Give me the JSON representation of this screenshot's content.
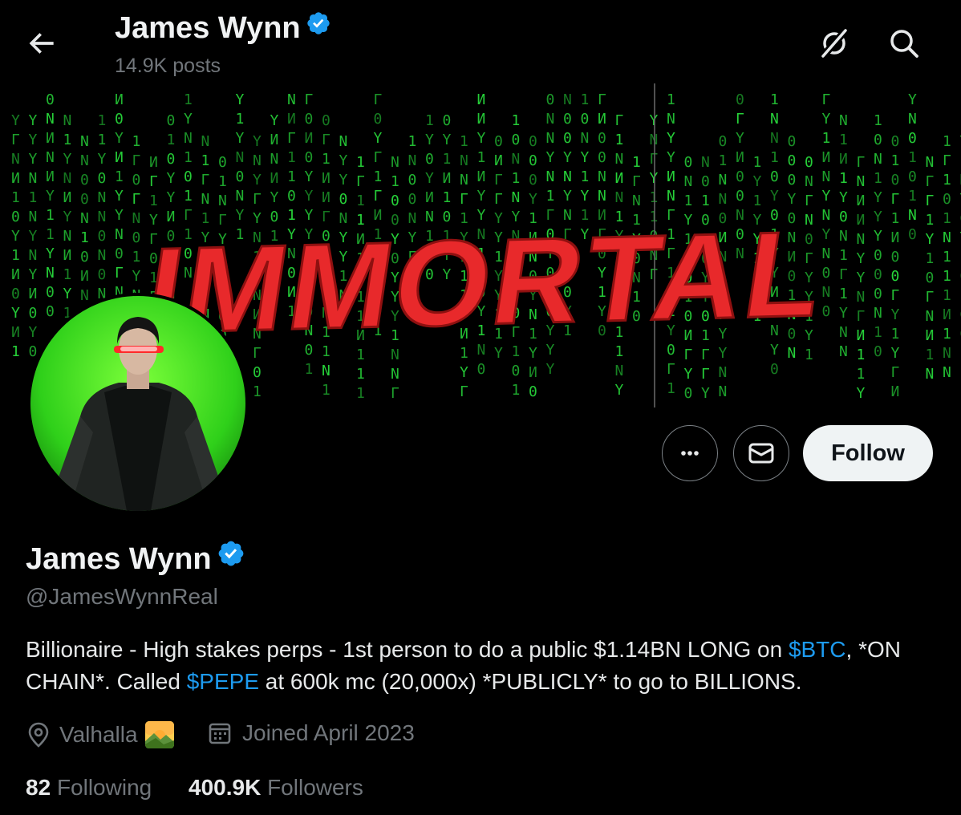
{
  "header": {
    "name": "James Wynn",
    "posts": "14.9K posts",
    "back_icon": "arrow-left-icon",
    "grok_icon": "grok-icon",
    "search_icon": "search-icon"
  },
  "banner": {
    "title": "IMMORTAL",
    "title_color": "#e8292b",
    "rain_color": "#27d43a"
  },
  "actions": {
    "more_icon": "more-dots-icon",
    "message_icon": "envelope-icon",
    "follow_label": "Follow"
  },
  "profile": {
    "name": "James Wynn",
    "verified_color": "#1d9bf0",
    "handle": "@JamesWynnReal",
    "bio": {
      "part1": "Billionaire - High stakes perps - 1st person to do a public $1.14BN LONG on ",
      "link1": "$BTC",
      "part2": ", *ON CHAIN*. Called ",
      "link2": "$PEPE",
      "part3": " at 600k mc (20,000x) *PUBLICLY* to go to BILLIONS."
    },
    "location": "Valhalla",
    "joined": "Joined April 2023",
    "following_count": "82",
    "following_label": "Following",
    "followers_count": "400.9K",
    "followers_label": "Followers"
  },
  "colors": {
    "accent": "#1d9bf0",
    "muted": "#71767b",
    "background": "#000000"
  }
}
